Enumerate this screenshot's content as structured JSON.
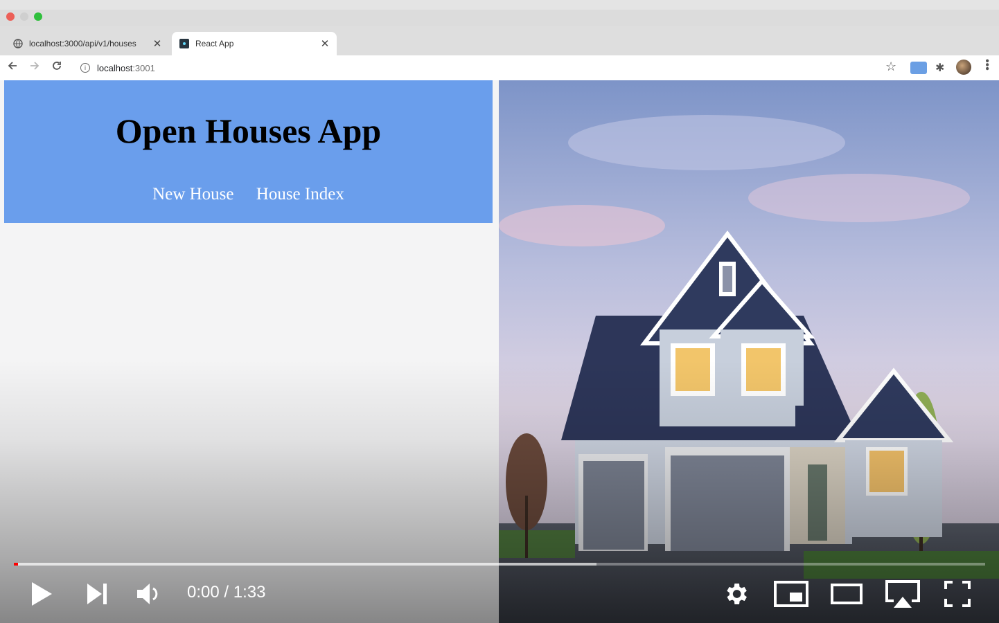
{
  "browser": {
    "tabs": [
      {
        "label": "localhost:3000/api/v1/houses",
        "icon": "globe-icon",
        "active": false
      },
      {
        "label": "React App",
        "icon": "react-app-favicon",
        "active": true
      }
    ],
    "address": {
      "host": "localhost",
      "port": ":3001"
    }
  },
  "app": {
    "title": "Open Houses App",
    "nav": [
      {
        "label": "New House"
      },
      {
        "label": "House Index"
      }
    ],
    "header_color": "#6a9eec"
  },
  "player": {
    "current_time": "0:00",
    "separator": " / ",
    "duration": "1:33",
    "progress_played_fraction": 0.0,
    "progress_buffered_fraction": 0.6,
    "accent_color": "#ff0000"
  }
}
